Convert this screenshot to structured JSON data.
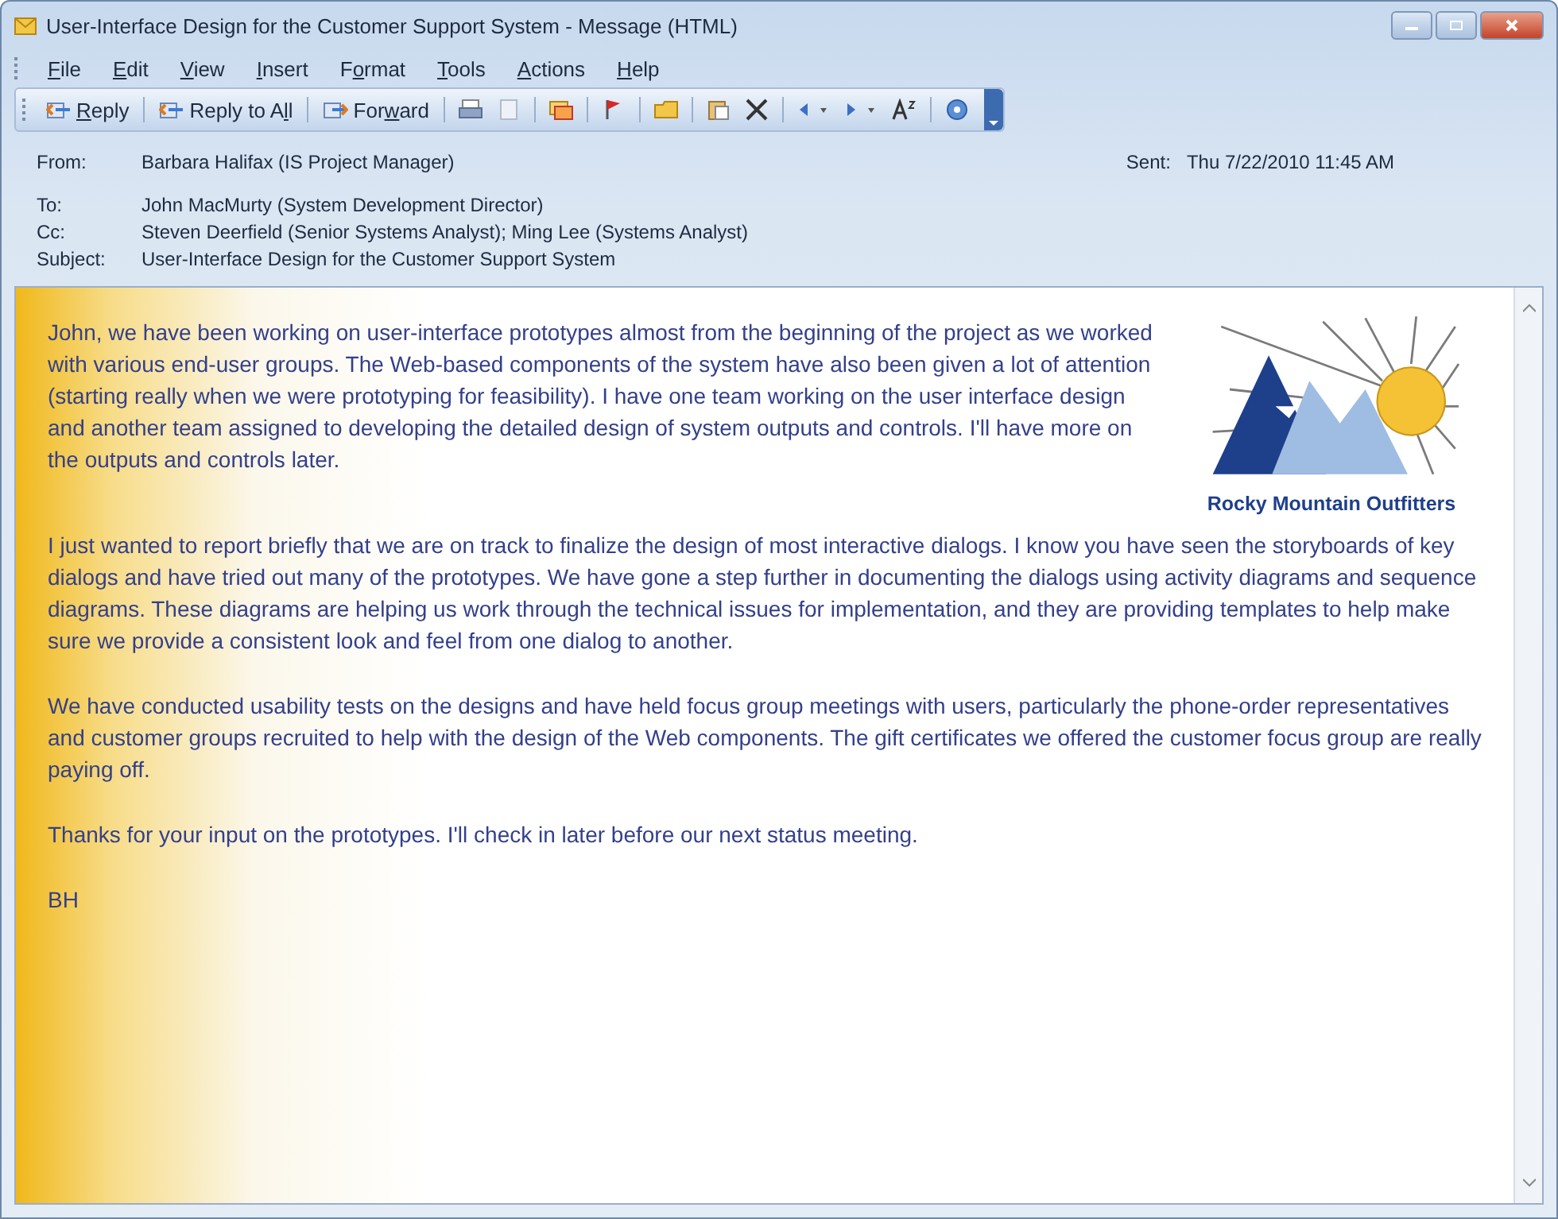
{
  "window": {
    "title": "User-Interface Design for the Customer Support System - Message (HTML)"
  },
  "menu": [
    {
      "key": "F",
      "after": "ile"
    },
    {
      "key": "E",
      "after": "dit"
    },
    {
      "key": "V",
      "after": "iew"
    },
    {
      "key": "I",
      "after": "nsert"
    },
    {
      "before": "F",
      "key": "o",
      "after": "rmat"
    },
    {
      "key": "T",
      "after": "ools"
    },
    {
      "key": "A",
      "after": "ctions"
    },
    {
      "key": "H",
      "after": "elp"
    }
  ],
  "toolbar": [
    {
      "key": "R",
      "after": "eply"
    },
    {
      "before": "Reply to A",
      "key": "l",
      "after": "l"
    },
    {
      "before": "For",
      "key": "w",
      "after": "ard"
    }
  ],
  "header": {
    "fields": [
      {
        "label": "From:",
        "value": "Barbara Halifax (IS Project Manager)"
      },
      {
        "label": "To:",
        "value": "John MacMurty (System Development Director)"
      },
      {
        "label": "Cc:",
        "value": "Steven Deerfield (Senior Systems Analyst); Ming Lee (Systems Analyst)"
      },
      {
        "label": "Subject:",
        "value": "User-Interface Design for the Customer Support System"
      }
    ],
    "sent": {
      "label": "Sent:",
      "value": "Thu 7/22/2010 11:45 AM"
    }
  },
  "logo": {
    "caption": "Rocky Mountain Outfitters"
  },
  "body": [
    "John, we have been working on user-interface prototypes almost from the beginning of the project as we worked with various end-user groups. The Web-based components of the system have also been given a lot of attention (starting really when we were prototyping for feasibility). I have one team working on the user interface design and another team assigned to developing the detailed design of system outputs and controls. I'll have more on the outputs and controls later.",
    "I just wanted to report briefly that we are on track to finalize the design of most interactive dialogs. I know you have seen the storyboards of key dialogs and have tried out many of the prototypes. We have gone a step further in documenting the dialogs using activity diagrams and sequence diagrams. These diagrams are helping us work through the technical issues for implementation, and they are providing templates to help make sure we provide a consistent look and feel from one dialog to another.",
    "We have conducted usability tests on the designs and have held focus group meetings with users, particularly the phone-order representatives and customer groups recruited to help with the design of the Web components. The gift certificates we offered the customer focus group are really paying off.",
    "Thanks for your input on the prototypes. I'll check in later before our next status meeting.",
    "BH"
  ]
}
